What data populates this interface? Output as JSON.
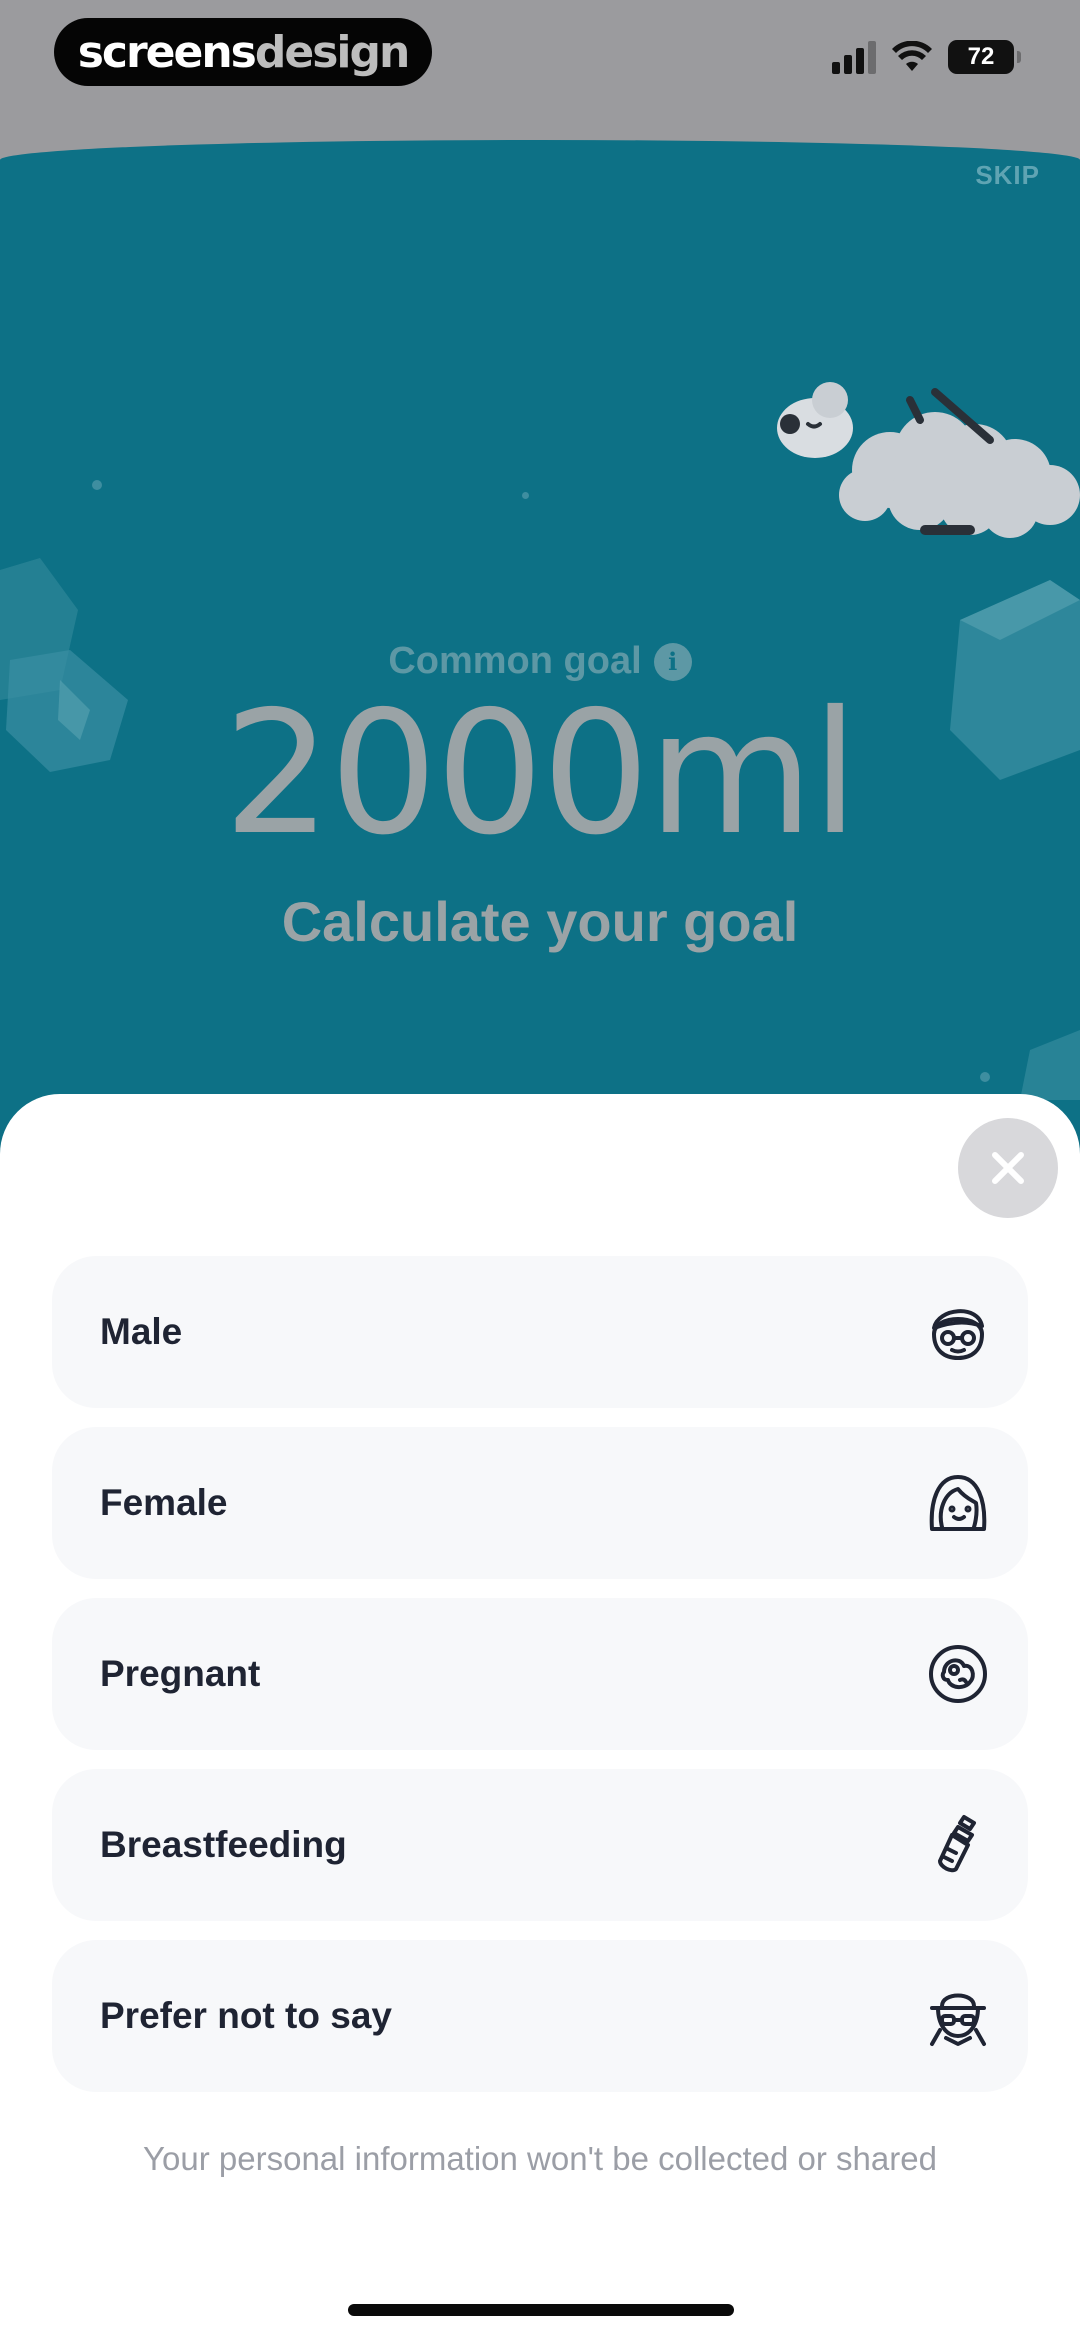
{
  "status_bar": {
    "brand_part1": "screens",
    "brand_part2": "design",
    "battery": "72"
  },
  "header": {
    "skip_label": "SKIP"
  },
  "goal": {
    "caption": "Common goal",
    "info_glyph": "i",
    "amount": "2000ml",
    "cta": "Calculate your goal"
  },
  "sheet": {
    "options": [
      {
        "label": "Male",
        "icon": "man-face-glasses-icon"
      },
      {
        "label": "Female",
        "icon": "woman-face-icon"
      },
      {
        "label": "Pregnant",
        "icon": "fetus-icon"
      },
      {
        "label": "Breastfeeding",
        "icon": "baby-bottle-icon"
      },
      {
        "label": "Prefer not to say",
        "icon": "incognito-hat-icon"
      }
    ],
    "privacy_note": "Your personal information won't be collected or shared"
  },
  "colors": {
    "scene_background": "#0d7186",
    "sheet_background": "#ffffff",
    "option_background": "#f7f8fa",
    "text_dark": "#1f2433"
  }
}
